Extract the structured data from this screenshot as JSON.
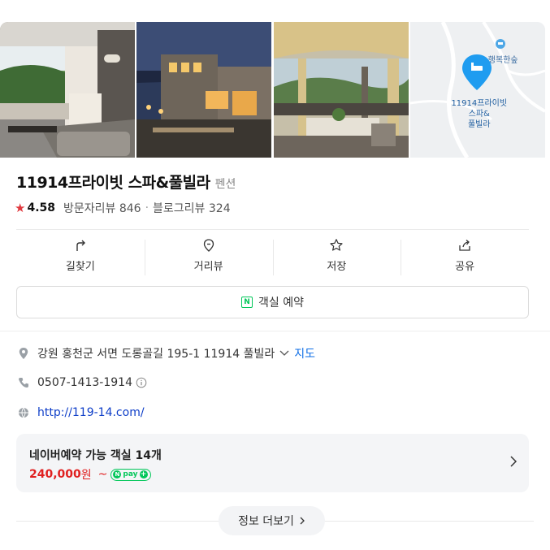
{
  "place": {
    "name": "11914프라이빗 스파&풀빌라",
    "category": "펜션",
    "rating": "4.58",
    "visitor_reviews_label": "방문자리뷰 846",
    "blog_reviews_label": "블로그리뷰 324"
  },
  "map": {
    "marker_label_line1": "11914프라이빗",
    "marker_label_line2": "스파&",
    "marker_label_line3": "풀빌라",
    "nearby_label": "행복한숲"
  },
  "actions": [
    {
      "label": "길찾기",
      "icon": "directions-icon"
    },
    {
      "label": "거리뷰",
      "icon": "street-view-icon"
    },
    {
      "label": "저장",
      "icon": "star-icon"
    },
    {
      "label": "공유",
      "icon": "share-icon"
    }
  ],
  "reserve_label": "객실 예약",
  "info": {
    "address": "강원 홍천군 서면 도롱골길 195-1 11914 풀빌라",
    "map_link": "지도",
    "phone": "0507-1413-1914",
    "website": "http://119-14.com/"
  },
  "booking": {
    "title": "네이버예약 가능 객실 14개",
    "price": "240,000",
    "price_unit": "원",
    "tilde": "~",
    "npay_text": "pay"
  },
  "more_label": "정보 더보기",
  "colors": {
    "accent_red": "#e02020",
    "naver_green": "#03c75a",
    "link_blue": "#0e3ec8",
    "map_marker": "#1f9cf0"
  }
}
